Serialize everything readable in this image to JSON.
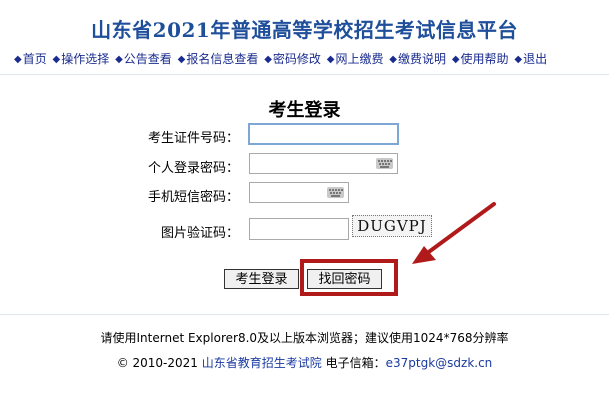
{
  "header": {
    "title": "山东省2021年普通高等学校招生考试信息平台",
    "nav": [
      "首页",
      "操作选择",
      "公告查看",
      "报名信息查看",
      "密码修改",
      "网上缴费",
      "缴费说明",
      "使用帮助",
      "退出"
    ]
  },
  "login": {
    "title": "考生登录",
    "id_label": "考生证件号码：",
    "password_label": "个人登录密码：",
    "sms_label": "手机短信密码：",
    "captcha_label": "图片验证码：",
    "captcha_text": "DUGVPJ",
    "login_button": "考生登录",
    "recover_button": "找回密码"
  },
  "footer": {
    "browser_note": "请使用Internet Explorer8.0及以上版本浏览器；建议使用1024*768分辨率",
    "copyright": "© 2010-2021",
    "org": "山东省教育招生考试院",
    "email_label": "电子信箱：",
    "email": "e37ptgk@sdzk.cn"
  },
  "colors": {
    "title": "#1f4f9a",
    "nav": "#1a2c8f",
    "highlight": "#b11a1a"
  }
}
